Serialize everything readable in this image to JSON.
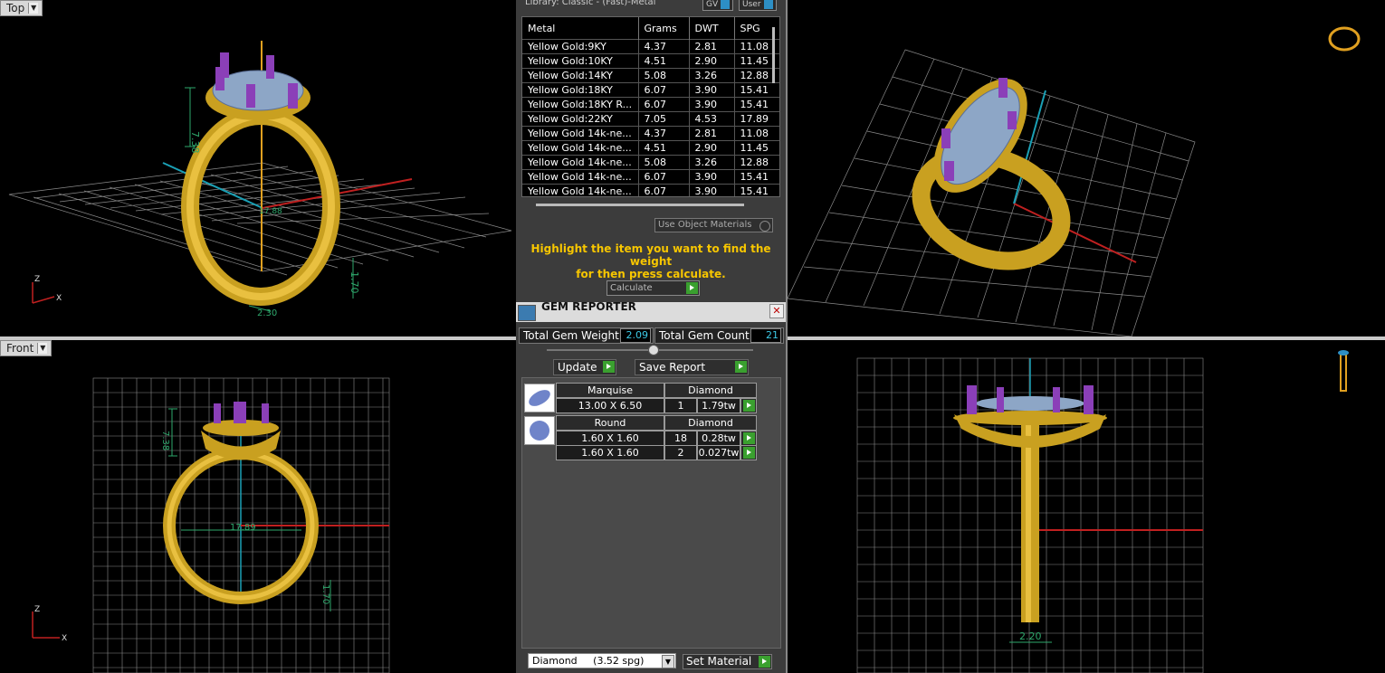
{
  "viewports": {
    "top_label": "Top",
    "front_label": "Front",
    "dims": {
      "top_height": "7.38",
      "top_width": "1.70",
      "top_bottom": "2.30",
      "top_center": "17.88",
      "front_height": "7.38",
      "front_center": "17.89",
      "front_side": "1.70",
      "right_bottom": "2.20"
    },
    "axes": {
      "z": "Z",
      "x": "X"
    }
  },
  "library": {
    "title": "Library: Classic - (Fast)-Metal",
    "gv_label": "GV",
    "user_label": "User",
    "columns": [
      "Metal",
      "Grams",
      "DWT",
      "SPG"
    ],
    "rows": [
      [
        "Yellow Gold:9KY",
        "4.37",
        "2.81",
        "11.08"
      ],
      [
        "Yellow Gold:10KY",
        "4.51",
        "2.90",
        "11.45"
      ],
      [
        "Yellow Gold:14KY",
        "5.08",
        "3.26",
        "12.88"
      ],
      [
        "Yellow Gold:18KY",
        "6.07",
        "3.90",
        "15.41"
      ],
      [
        "Yellow Gold:18KY R...",
        "6.07",
        "3.90",
        "15.41"
      ],
      [
        "Yellow Gold:22KY",
        "7.05",
        "4.53",
        "17.89"
      ],
      [
        "Yellow Gold 14k-ne...",
        "4.37",
        "2.81",
        "11.08"
      ],
      [
        "Yellow Gold 14k-ne...",
        "4.51",
        "2.90",
        "11.45"
      ],
      [
        "Yellow Gold 14k-ne...",
        "5.08",
        "3.26",
        "12.88"
      ],
      [
        "Yellow Gold 14k-ne...",
        "6.07",
        "3.90",
        "15.41"
      ],
      [
        "Yellow Gold 14k-ne...",
        "6.07",
        "3.90",
        "15.41"
      ]
    ],
    "use_object_materials": "Use Object Materials",
    "instructions_line1": "Highlight the item you want to find the weight",
    "instructions_line2": "for then press calculate.",
    "calculate_label": "Calculate"
  },
  "gem_reporter": {
    "title": "GEM REPORTER",
    "total_weight_label": "Total Gem Weight",
    "total_weight_value": "2.09",
    "total_count_label": "Total Gem Count",
    "total_count_value": "21",
    "update_label": "Update",
    "save_report_label": "Save Report",
    "gems": [
      {
        "shape": "Marquise",
        "material": "Diamond",
        "size": "13.00 X 6.50",
        "count": "1",
        "weight": "1.79tw"
      },
      {
        "shape": "Round",
        "material": "Diamond",
        "size": "1.60 X 1.60",
        "count": "18",
        "weight": "0.28tw",
        "size2": "1.60 X 1.60",
        "count2": "2",
        "weight2": "0.027tw"
      }
    ],
    "material_select": "Diamond     (3.52 spg)",
    "set_material_label": "Set Material"
  }
}
